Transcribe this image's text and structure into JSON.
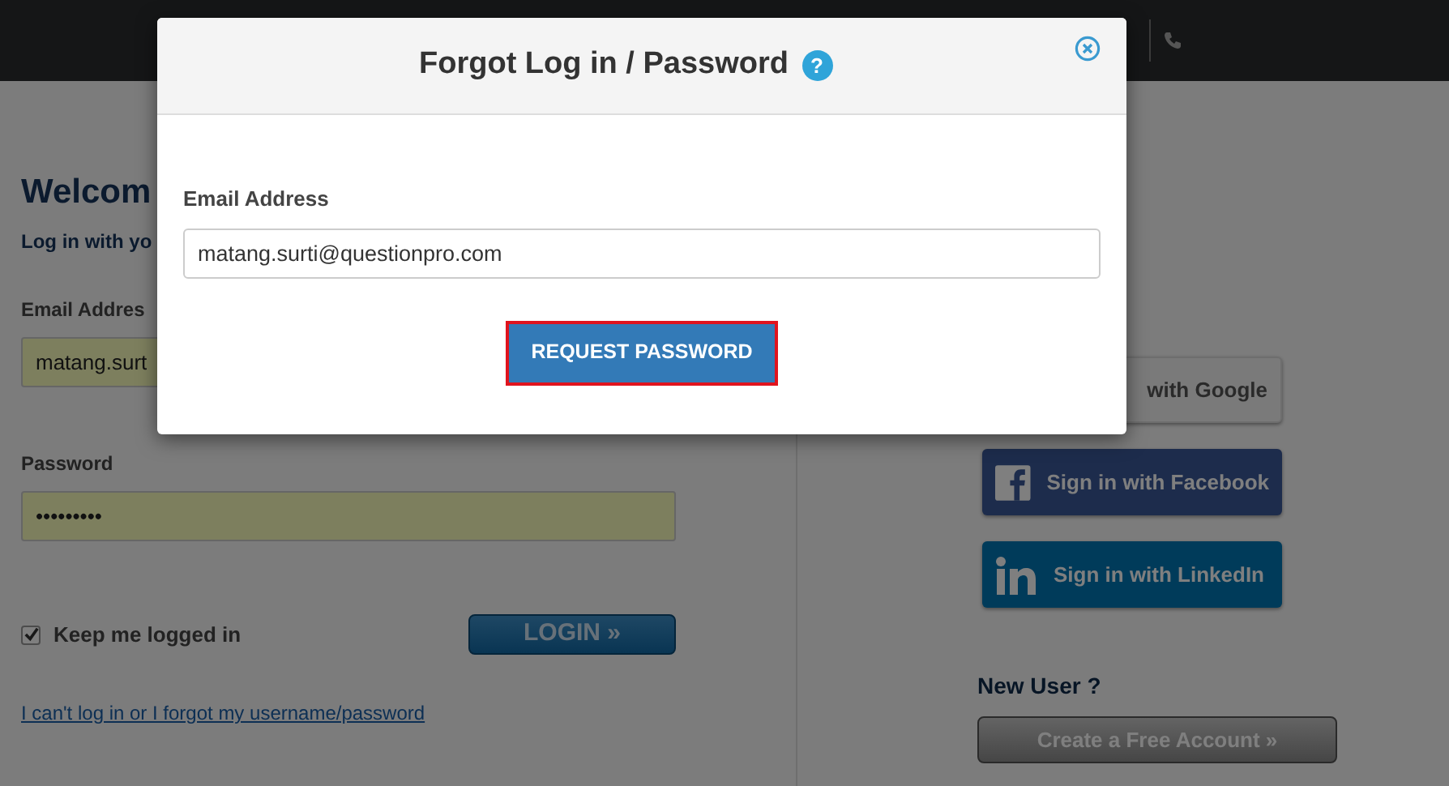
{
  "login_form": {
    "heading": "Welcom",
    "subheading": "Log in with yo",
    "email_label": "Email Addres",
    "email_value": "matang.surt",
    "password_label": "Password",
    "password_value": "•••••••••",
    "keep_logged_in": {
      "label": "Keep me logged in",
      "checked": true
    },
    "login_button": "LOGIN »",
    "forgot_link": "I can't log in or I forgot my username/password"
  },
  "social_buttons": [
    {
      "kind": "google",
      "label": "with Google"
    },
    {
      "kind": "facebook",
      "label": "Sign in with Facebook"
    },
    {
      "kind": "linkedin",
      "label": "Sign in with LinkedIn"
    }
  ],
  "new_user": {
    "heading": "New User ?",
    "button": "Create a Free Account »"
  },
  "modal": {
    "title": "Forgot Log in / Password",
    "help_glyph": "?",
    "email_label": "Email Address",
    "email_value": "matang.surti@questionpro.com",
    "submit": {
      "label": "REQUEST PASSWORD",
      "highlighted": true
    }
  }
}
